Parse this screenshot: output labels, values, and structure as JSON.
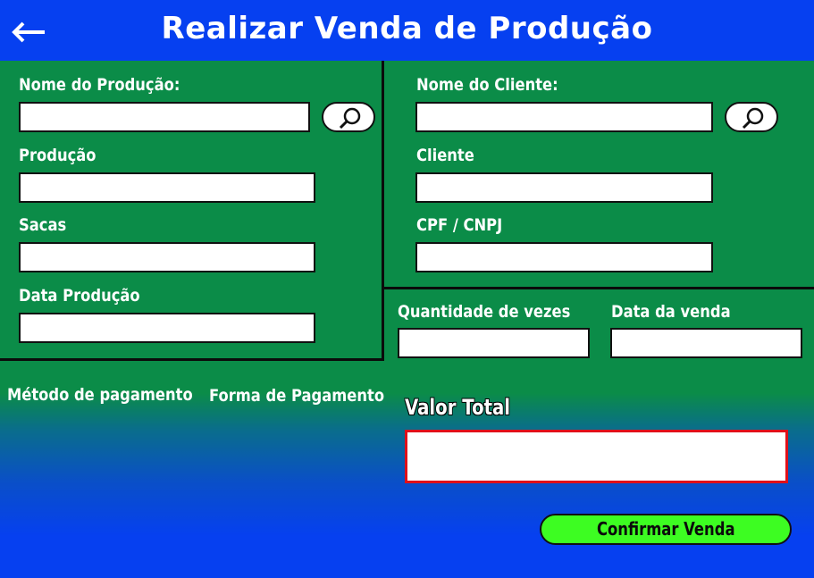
{
  "header": {
    "title": "Realizar Venda de Produção",
    "back_icon": "arrow-left-icon"
  },
  "producao_section": {
    "nome_producao_label": "Nome do Produção:",
    "nome_producao_value": "",
    "producao_label": "Produção",
    "producao_value": "",
    "sacas_label": "Sacas",
    "sacas_value": "",
    "data_producao_label": "Data Produção",
    "data_producao_value": "",
    "search_icon": "magnifier-icon"
  },
  "cliente_section": {
    "nome_cliente_label": "Nome do Cliente:",
    "nome_cliente_value": "",
    "cliente_label": "Cliente",
    "cliente_value": "",
    "cpf_cnpj_label": "CPF / CNPJ",
    "cpf_cnpj_value": "",
    "search_icon": "magnifier-icon"
  },
  "venda_section": {
    "quantidade_label": "Quantidade de vezes",
    "quantidade_value": "",
    "data_venda_label": "Data da venda",
    "data_venda_value": ""
  },
  "pagamento": {
    "metodo_label": "Método de pagamento",
    "forma_label": "Forma de Pagamento"
  },
  "total": {
    "label": "Valor Total",
    "value": ""
  },
  "actions": {
    "confirm_label": "Confirmar Venda"
  },
  "colors": {
    "blue": "#0640f0",
    "green": "#0b8c48",
    "confirm_green": "#3dfd22",
    "total_border": "#e0101a"
  }
}
